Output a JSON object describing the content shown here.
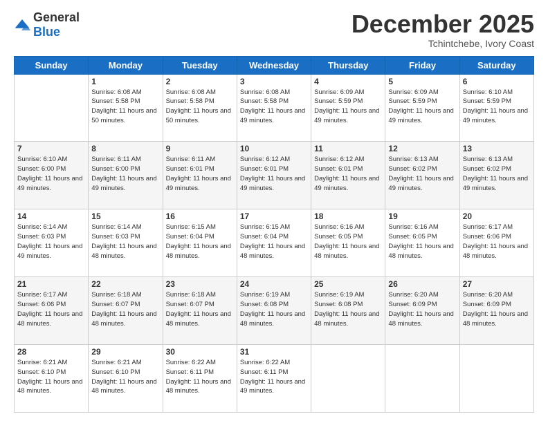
{
  "logo": {
    "general": "General",
    "blue": "Blue"
  },
  "header": {
    "month": "December 2025",
    "location": "Tchintchebe, Ivory Coast"
  },
  "days": [
    "Sunday",
    "Monday",
    "Tuesday",
    "Wednesday",
    "Thursday",
    "Friday",
    "Saturday"
  ],
  "weeks": [
    [
      {
        "day": "",
        "sunrise": "",
        "sunset": "",
        "daylight": ""
      },
      {
        "day": "1",
        "sunrise": "Sunrise: 6:08 AM",
        "sunset": "Sunset: 5:58 PM",
        "daylight": "Daylight: 11 hours and 50 minutes."
      },
      {
        "day": "2",
        "sunrise": "Sunrise: 6:08 AM",
        "sunset": "Sunset: 5:58 PM",
        "daylight": "Daylight: 11 hours and 50 minutes."
      },
      {
        "day": "3",
        "sunrise": "Sunrise: 6:08 AM",
        "sunset": "Sunset: 5:58 PM",
        "daylight": "Daylight: 11 hours and 49 minutes."
      },
      {
        "day": "4",
        "sunrise": "Sunrise: 6:09 AM",
        "sunset": "Sunset: 5:59 PM",
        "daylight": "Daylight: 11 hours and 49 minutes."
      },
      {
        "day": "5",
        "sunrise": "Sunrise: 6:09 AM",
        "sunset": "Sunset: 5:59 PM",
        "daylight": "Daylight: 11 hours and 49 minutes."
      },
      {
        "day": "6",
        "sunrise": "Sunrise: 6:10 AM",
        "sunset": "Sunset: 5:59 PM",
        "daylight": "Daylight: 11 hours and 49 minutes."
      }
    ],
    [
      {
        "day": "7",
        "sunrise": "Sunrise: 6:10 AM",
        "sunset": "Sunset: 6:00 PM",
        "daylight": "Daylight: 11 hours and 49 minutes."
      },
      {
        "day": "8",
        "sunrise": "Sunrise: 6:11 AM",
        "sunset": "Sunset: 6:00 PM",
        "daylight": "Daylight: 11 hours and 49 minutes."
      },
      {
        "day": "9",
        "sunrise": "Sunrise: 6:11 AM",
        "sunset": "Sunset: 6:01 PM",
        "daylight": "Daylight: 11 hours and 49 minutes."
      },
      {
        "day": "10",
        "sunrise": "Sunrise: 6:12 AM",
        "sunset": "Sunset: 6:01 PM",
        "daylight": "Daylight: 11 hours and 49 minutes."
      },
      {
        "day": "11",
        "sunrise": "Sunrise: 6:12 AM",
        "sunset": "Sunset: 6:01 PM",
        "daylight": "Daylight: 11 hours and 49 minutes."
      },
      {
        "day": "12",
        "sunrise": "Sunrise: 6:13 AM",
        "sunset": "Sunset: 6:02 PM",
        "daylight": "Daylight: 11 hours and 49 minutes."
      },
      {
        "day": "13",
        "sunrise": "Sunrise: 6:13 AM",
        "sunset": "Sunset: 6:02 PM",
        "daylight": "Daylight: 11 hours and 49 minutes."
      }
    ],
    [
      {
        "day": "14",
        "sunrise": "Sunrise: 6:14 AM",
        "sunset": "Sunset: 6:03 PM",
        "daylight": "Daylight: 11 hours and 49 minutes."
      },
      {
        "day": "15",
        "sunrise": "Sunrise: 6:14 AM",
        "sunset": "Sunset: 6:03 PM",
        "daylight": "Daylight: 11 hours and 48 minutes."
      },
      {
        "day": "16",
        "sunrise": "Sunrise: 6:15 AM",
        "sunset": "Sunset: 6:04 PM",
        "daylight": "Daylight: 11 hours and 48 minutes."
      },
      {
        "day": "17",
        "sunrise": "Sunrise: 6:15 AM",
        "sunset": "Sunset: 6:04 PM",
        "daylight": "Daylight: 11 hours and 48 minutes."
      },
      {
        "day": "18",
        "sunrise": "Sunrise: 6:16 AM",
        "sunset": "Sunset: 6:05 PM",
        "daylight": "Daylight: 11 hours and 48 minutes."
      },
      {
        "day": "19",
        "sunrise": "Sunrise: 6:16 AM",
        "sunset": "Sunset: 6:05 PM",
        "daylight": "Daylight: 11 hours and 48 minutes."
      },
      {
        "day": "20",
        "sunrise": "Sunrise: 6:17 AM",
        "sunset": "Sunset: 6:06 PM",
        "daylight": "Daylight: 11 hours and 48 minutes."
      }
    ],
    [
      {
        "day": "21",
        "sunrise": "Sunrise: 6:17 AM",
        "sunset": "Sunset: 6:06 PM",
        "daylight": "Daylight: 11 hours and 48 minutes."
      },
      {
        "day": "22",
        "sunrise": "Sunrise: 6:18 AM",
        "sunset": "Sunset: 6:07 PM",
        "daylight": "Daylight: 11 hours and 48 minutes."
      },
      {
        "day": "23",
        "sunrise": "Sunrise: 6:18 AM",
        "sunset": "Sunset: 6:07 PM",
        "daylight": "Daylight: 11 hours and 48 minutes."
      },
      {
        "day": "24",
        "sunrise": "Sunrise: 6:19 AM",
        "sunset": "Sunset: 6:08 PM",
        "daylight": "Daylight: 11 hours and 48 minutes."
      },
      {
        "day": "25",
        "sunrise": "Sunrise: 6:19 AM",
        "sunset": "Sunset: 6:08 PM",
        "daylight": "Daylight: 11 hours and 48 minutes."
      },
      {
        "day": "26",
        "sunrise": "Sunrise: 6:20 AM",
        "sunset": "Sunset: 6:09 PM",
        "daylight": "Daylight: 11 hours and 48 minutes."
      },
      {
        "day": "27",
        "sunrise": "Sunrise: 6:20 AM",
        "sunset": "Sunset: 6:09 PM",
        "daylight": "Daylight: 11 hours and 48 minutes."
      }
    ],
    [
      {
        "day": "28",
        "sunrise": "Sunrise: 6:21 AM",
        "sunset": "Sunset: 6:10 PM",
        "daylight": "Daylight: 11 hours and 48 minutes."
      },
      {
        "day": "29",
        "sunrise": "Sunrise: 6:21 AM",
        "sunset": "Sunset: 6:10 PM",
        "daylight": "Daylight: 11 hours and 48 minutes."
      },
      {
        "day": "30",
        "sunrise": "Sunrise: 6:22 AM",
        "sunset": "Sunset: 6:11 PM",
        "daylight": "Daylight: 11 hours and 48 minutes."
      },
      {
        "day": "31",
        "sunrise": "Sunrise: 6:22 AM",
        "sunset": "Sunset: 6:11 PM",
        "daylight": "Daylight: 11 hours and 49 minutes."
      },
      {
        "day": "",
        "sunrise": "",
        "sunset": "",
        "daylight": ""
      },
      {
        "day": "",
        "sunrise": "",
        "sunset": "",
        "daylight": ""
      },
      {
        "day": "",
        "sunrise": "",
        "sunset": "",
        "daylight": ""
      }
    ]
  ]
}
